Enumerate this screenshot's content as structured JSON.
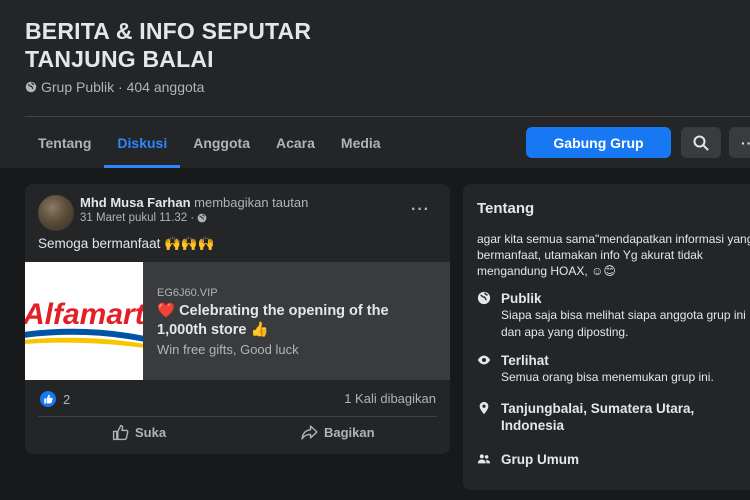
{
  "group": {
    "title": "BERITA & INFO SEPUTAR TANJUNG BALAI",
    "meta": "Grup Publik · 404 anggota"
  },
  "tabs": [
    {
      "label": "Tentang"
    },
    {
      "label": "Diskusi"
    },
    {
      "label": "Anggota"
    },
    {
      "label": "Acara"
    },
    {
      "label": "Media"
    }
  ],
  "active_tab": "Diskusi",
  "actions": {
    "join_label": "Gabung Grup",
    "more_label": "···"
  },
  "post": {
    "author": "Mhd Musa Farhan",
    "action_text": "membagikan tautan",
    "time": "31 Maret pukul 11.32 ·",
    "text": "Semoga bermanfaat 🙌🙌🙌",
    "menu_label": "···",
    "link": {
      "domain": "EG6J60.VIP",
      "title": "❤️ Celebrating the opening of the 1,000th store 👍",
      "description": "Win free gifts, Good luck",
      "logo_text": "Alfamart"
    },
    "like_count": "2",
    "shares": "1 Kali dibagikan",
    "like_label": "Suka",
    "share_label": "Bagikan"
  },
  "about": {
    "title": "Tentang",
    "description": "agar kita semua sama\"mendapatkan informasi yang bermanfaat, utamakan info Yg akurat tidak mengandung HOAX, ☺😊",
    "items": [
      {
        "icon": "globe-icon",
        "title": "Publik",
        "desc": "Siapa saja bisa melihat siapa anggota grup ini dan apa yang diposting."
      },
      {
        "icon": "eye-icon",
        "title": "Terlihat",
        "desc": "Semua orang bisa menemukan grup ini."
      },
      {
        "icon": "location-pin-icon",
        "title": "Tanjungbalai, Sumatera Utara, Indonesia",
        "desc": ""
      },
      {
        "icon": "people-icon",
        "title": "Grup Umum",
        "desc": ""
      }
    ]
  },
  "colors": {
    "background": "#18191a",
    "card": "#242526",
    "accent": "#2d88ff",
    "button": "#1877f2",
    "alfamart_red": "#e31e24",
    "alfamart_blue": "#0054a6"
  }
}
